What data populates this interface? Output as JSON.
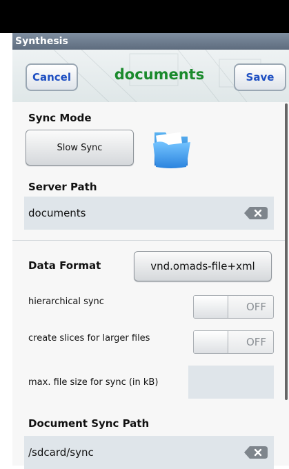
{
  "header": {
    "app_title": "Synthesis",
    "cancel_label": "Cancel",
    "title": "documents",
    "save_label": "Save"
  },
  "sync_mode": {
    "label": "Sync Mode",
    "button_label": "Slow Sync"
  },
  "server_path": {
    "label": "Server Path",
    "value": "documents"
  },
  "data_format": {
    "label": "Data Format",
    "value": "vnd.omads-file+xml"
  },
  "hierarchical_sync": {
    "label": "hierarchical sync",
    "state": "OFF"
  },
  "slices": {
    "label": "create slices for larger files",
    "state": "OFF"
  },
  "max_file_size": {
    "label": "max. file size for sync (in kB)",
    "value": ""
  },
  "document_sync_path": {
    "label": "Document Sync Path",
    "value": "/sdcard/sync"
  },
  "icons": {
    "folder": "folder-icon",
    "clear": "backspace-clear-icon"
  },
  "colors": {
    "title_green": "#1a8a2c",
    "button_blue": "#1e4fc2",
    "field_bg": "#dfe5ea"
  }
}
